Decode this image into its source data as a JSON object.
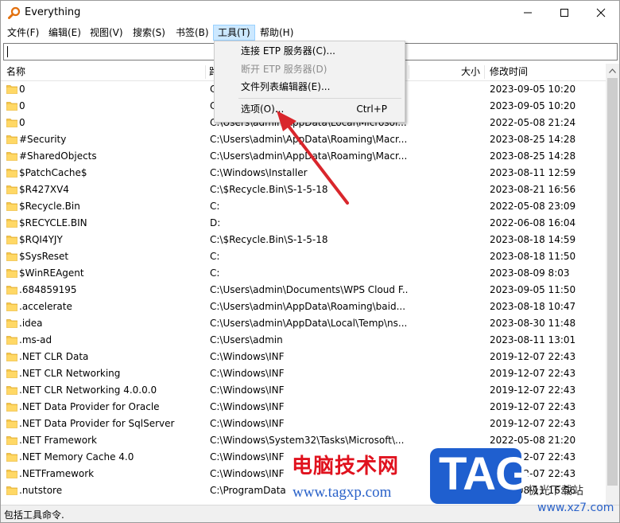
{
  "window": {
    "title": "Everything"
  },
  "menu": [
    "文件(F)",
    "编辑(E)",
    "视图(V)",
    "搜索(S)",
    "书签(B)",
    "工具(T)",
    "帮助(H)"
  ],
  "search": {
    "value": ""
  },
  "columns": {
    "name": "名称",
    "path": "路",
    "size": "大小",
    "modified": "修改时间"
  },
  "rows": [
    {
      "name": "0",
      "path": "C",
      "date": "2023-09-05 10:20"
    },
    {
      "name": "0",
      "path": "C",
      "date": "2023-09-05 10:20"
    },
    {
      "name": "0",
      "path": "C:\\Users\\admin\\AppData\\Local\\Microsof...",
      "date": "2022-05-08 21:24"
    },
    {
      "name": "#Security",
      "path": "C:\\Users\\admin\\AppData\\Roaming\\Macr...",
      "date": "2023-08-25 14:28"
    },
    {
      "name": "#SharedObjects",
      "path": "C:\\Users\\admin\\AppData\\Roaming\\Macr...",
      "date": "2023-08-25 14:28"
    },
    {
      "name": "$PatchCache$",
      "path": "C:\\Windows\\Installer",
      "date": "2023-08-11 12:59"
    },
    {
      "name": "$R427XV4",
      "path": "C:\\$Recycle.Bin\\S-1-5-18",
      "date": "2023-08-21 16:56"
    },
    {
      "name": "$Recycle.Bin",
      "path": "C:",
      "date": "2022-05-08 23:09"
    },
    {
      "name": "$RECYCLE.BIN",
      "path": "D:",
      "date": "2022-06-08 16:04"
    },
    {
      "name": "$RQI4YJY",
      "path": "C:\\$Recycle.Bin\\S-1-5-18",
      "date": "2023-08-18 14:59"
    },
    {
      "name": "$SysReset",
      "path": "C:",
      "date": "2023-08-18 11:50"
    },
    {
      "name": "$WinREAgent",
      "path": "C:",
      "date": "2023-08-09 8:03"
    },
    {
      "name": ".684859195",
      "path": "C:\\Users\\admin\\Documents\\WPS Cloud F...",
      "date": "2023-09-05 11:50"
    },
    {
      "name": ".accelerate",
      "path": "C:\\Users\\admin\\AppData\\Roaming\\baid...",
      "date": "2023-08-18 10:47"
    },
    {
      "name": ".idea",
      "path": "C:\\Users\\admin\\AppData\\Local\\Temp\\ns...",
      "date": "2023-08-30 11:48"
    },
    {
      "name": ".ms-ad",
      "path": "C:\\Users\\admin",
      "date": "2023-08-11 13:01"
    },
    {
      "name": ".NET CLR Data",
      "path": "C:\\Windows\\INF",
      "date": "2019-12-07 22:43"
    },
    {
      "name": ".NET CLR Networking",
      "path": "C:\\Windows\\INF",
      "date": "2019-12-07 22:43"
    },
    {
      "name": ".NET CLR Networking 4.0.0.0",
      "path": "C:\\Windows\\INF",
      "date": "2019-12-07 22:43"
    },
    {
      "name": ".NET Data Provider for Oracle",
      "path": "C:\\Windows\\INF",
      "date": "2019-12-07 22:43"
    },
    {
      "name": ".NET Data Provider for SqlServer",
      "path": "C:\\Windows\\INF",
      "date": "2019-12-07 22:43"
    },
    {
      "name": ".NET Framework",
      "path": "C:\\Windows\\System32\\Tasks\\Microsoft\\...",
      "date": "2022-05-08 21:20"
    },
    {
      "name": ".NET Memory Cache 4.0",
      "path": "C:\\Windows\\INF",
      "date": "2019-12-07 22:43"
    },
    {
      "name": ".NETFramework",
      "path": "C:\\Windows\\INF",
      "date": "2019-12-07 22:43"
    },
    {
      "name": ".nutstore",
      "path": "C:\\ProgramData",
      "date": "2023-08-11 16:56"
    }
  ],
  "status": {
    "text": "包括工具命令."
  },
  "tools_menu": {
    "items": [
      {
        "label": "连接 ETP 服务器(C)...",
        "shortcut": ""
      },
      {
        "label": "断开 ETP 服务器(D)",
        "shortcut": ""
      },
      {
        "label": "文件列表编辑器(E)...",
        "shortcut": ""
      },
      {
        "label": "选项(O)...",
        "shortcut": "Ctrl+P"
      }
    ]
  },
  "watermark": {
    "cn": "电脑技术网",
    "url": "www.tagxp.com",
    "logo": "TAG",
    "site": "极光下载站",
    "site_url": "www.xz7.com"
  },
  "colors": {
    "folder": "#f5c84c",
    "menu_highlight": "#cce8ff",
    "arrow": "#d9262c",
    "logo_bg": "#1f5fcf"
  }
}
